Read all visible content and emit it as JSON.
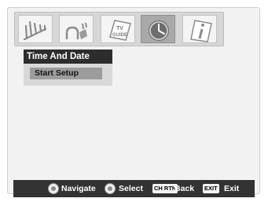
{
  "menu": {
    "title": "Time And Date",
    "items": [
      {
        "label": "Start Setup",
        "selected": true
      }
    ]
  },
  "icons": [
    {
      "name": "antenna-icon",
      "selected": false
    },
    {
      "name": "plug-icon",
      "selected": false
    },
    {
      "name": "tv-guide-icon",
      "text": "TV GUIDE",
      "selected": false
    },
    {
      "name": "clock-icon",
      "selected": true
    },
    {
      "name": "info-icon",
      "selected": false
    }
  ],
  "footer": {
    "navigate": "Navigate",
    "select": "Select",
    "back_key": "CH RTN",
    "back": "Back",
    "exit_key": "EXIT",
    "exit": "Exit"
  }
}
